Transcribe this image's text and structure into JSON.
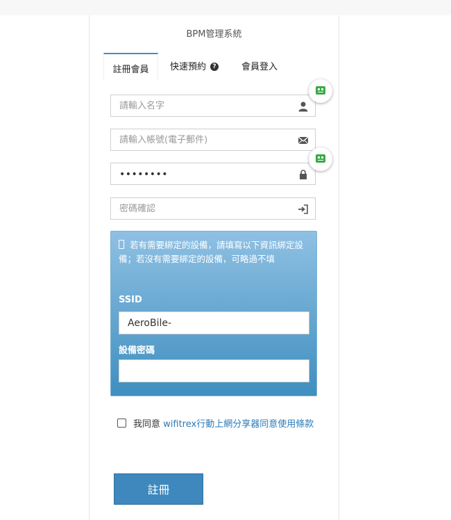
{
  "app_title": "BPM管理系統",
  "tabs": [
    {
      "label": "註冊會員",
      "active": true
    },
    {
      "label": "快速預約",
      "active": false,
      "icon": "help-circle-icon"
    },
    {
      "label": "會員登入",
      "active": false
    }
  ],
  "fields": {
    "name": {
      "placeholder": "請輸入名字",
      "icon": "user-icon"
    },
    "email": {
      "placeholder": "請輸入帳號(電子郵件)",
      "icon": "envelope-icon"
    },
    "password": {
      "value": "••••••••",
      "icon": "lock-icon"
    },
    "confirm": {
      "placeholder": "密碼確認",
      "icon": "sign-in-icon"
    }
  },
  "device": {
    "note": "若有需要綁定的設備，請填寫以下資訊綁定設備；若沒有需要綁定的設備，可略過不填",
    "ssid_label": "SSID",
    "ssid_value": "AeroBile-",
    "password_label": "設備密碼",
    "password_value": ""
  },
  "agreement": {
    "prefix": "我同意 ",
    "link": "wifitrex行動上網分享器同意使用條款"
  },
  "submit_label": "註冊",
  "colors": {
    "accent": "#3e88bd",
    "link": "#2a7ab8",
    "badge": "#3aaa45"
  }
}
